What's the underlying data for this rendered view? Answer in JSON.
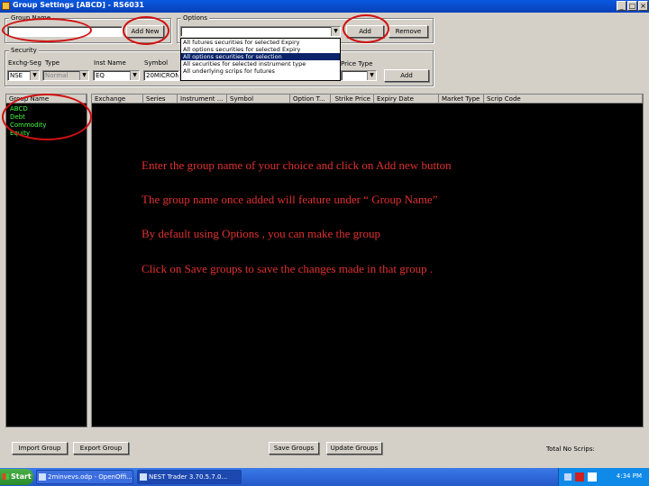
{
  "window": {
    "title": "Group Settings [ABCD] - RS6031"
  },
  "group_name": {
    "label": "Group Name",
    "value": "",
    "add_new_label": "Add New"
  },
  "options": {
    "label": "Options",
    "selected": "",
    "add_label": "Add",
    "remove_label": "Remove",
    "items": [
      "All futures securities for selected Expiry",
      "All options securities for selected Expiry",
      "All options securities for selection",
      "All securities for selected instrument type",
      "All underlying scrips for futures"
    ]
  },
  "security": {
    "label": "Security",
    "exch_seg_label": "Exchg-Seg",
    "type_label": "Type",
    "inst_name_label": "Inst Name",
    "symbol_label": "Symbol",
    "exch_seg_value": "NSE",
    "type_value": "Normal",
    "inst_name_value": "EQ",
    "symbol_value": "20MICRON",
    "price_label": "Price Type",
    "add_label": "Add"
  },
  "group_list": {
    "header": "Group Name",
    "items": [
      "ABCD",
      "Debt",
      "Commodity",
      "Equity"
    ]
  },
  "grid": {
    "columns": [
      "Exchange",
      "Series",
      "Instrument ...",
      "Symbol",
      "Option T...",
      "Strike Price",
      "Expiry Date",
      "Market Type",
      "Scrip Code"
    ]
  },
  "instructions": [
    "Enter the group name of your choice and click on Add new button",
    "The group name once added will feature under “ Group Name”",
    "By default using Options , you can make the group",
    "Click on Save groups to save the changes made in that group ."
  ],
  "footer": {
    "import_label": "Import Group",
    "export_label": "Export Group",
    "save_label": "Save Groups",
    "update_label": "Update Groups",
    "total_label": "Total No Scrips:"
  },
  "taskbar": {
    "start_label": "Start",
    "tasks": [
      "2minvevs.odp - OpenOffi...",
      "NEST Trader 3.70.5.7.0..."
    ],
    "clock": "4:34 PM"
  },
  "colors": {
    "highlight_circle": "#d01010",
    "instruction_text": "#e03030",
    "group_item_text": "#40ff40"
  }
}
